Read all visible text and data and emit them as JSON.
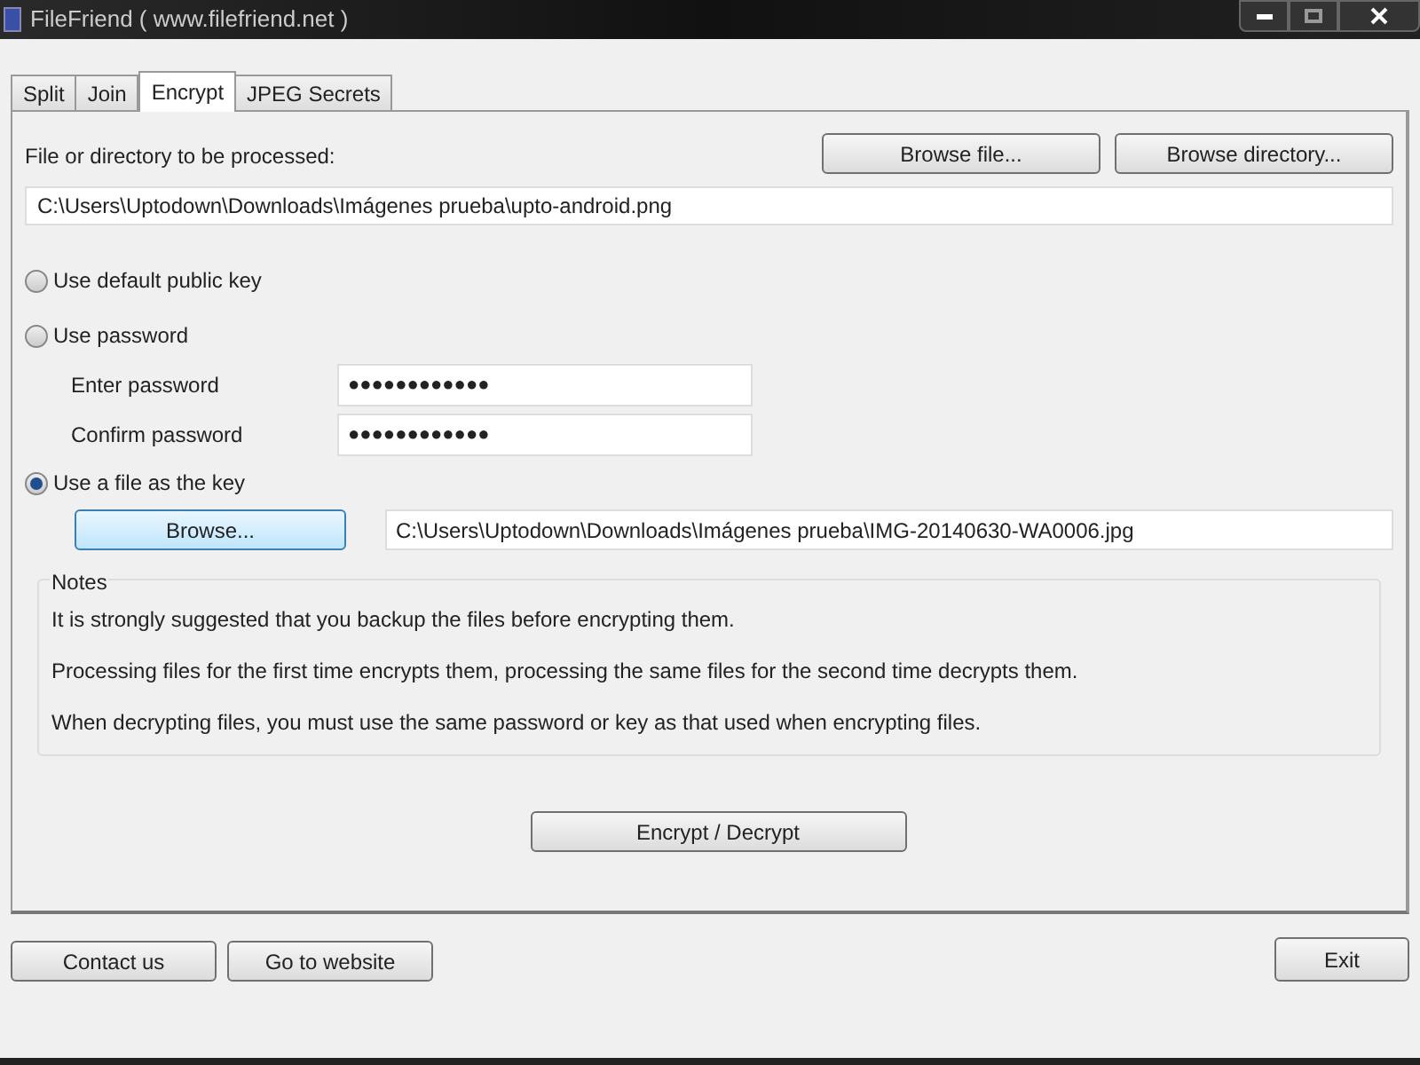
{
  "window": {
    "title": "FileFriend ( www.filefriend.net )"
  },
  "tabs": [
    {
      "label": "Split",
      "selected": false
    },
    {
      "label": "Join",
      "selected": false
    },
    {
      "label": "Encrypt",
      "selected": true
    },
    {
      "label": "JPEG Secrets",
      "selected": false
    }
  ],
  "file_label": "File or directory to be processed:",
  "browse_buttons": [
    "Browse file...",
    "Browse directory..."
  ],
  "file_path": "C:\\Users\\Uptodown\\Downloads\\Imágenes prueba\\upto-android.png",
  "key_options": [
    {
      "label": "Use default public key",
      "selected": false
    },
    {
      "label": "Use password",
      "selected": false
    },
    {
      "label": "Use a file as the key",
      "selected": true
    }
  ],
  "password_fields": [
    {
      "label": "Enter password",
      "value": "●●●●●●●●●●●●"
    },
    {
      "label": "Confirm password",
      "value": "●●●●●●●●●●●●"
    }
  ],
  "key_browse_button": "Browse...",
  "key_file_path": "C:\\Users\\Uptodown\\Downloads\\Imágenes prueba\\IMG-20140630-WA0006.jpg",
  "notes": {
    "title": "Notes",
    "lines": [
      "It is strongly suggested that you backup the files before encrypting them.",
      "Processing files for the first time encrypts them, processing the same files for the second time decrypts them.",
      "When decrypting files, you must use the same password or key as that used when encrypting files."
    ]
  },
  "action_button": "Encrypt / Decrypt",
  "footer_buttons": [
    "Contact us",
    "Go to website"
  ],
  "exit_button": "Exit"
}
